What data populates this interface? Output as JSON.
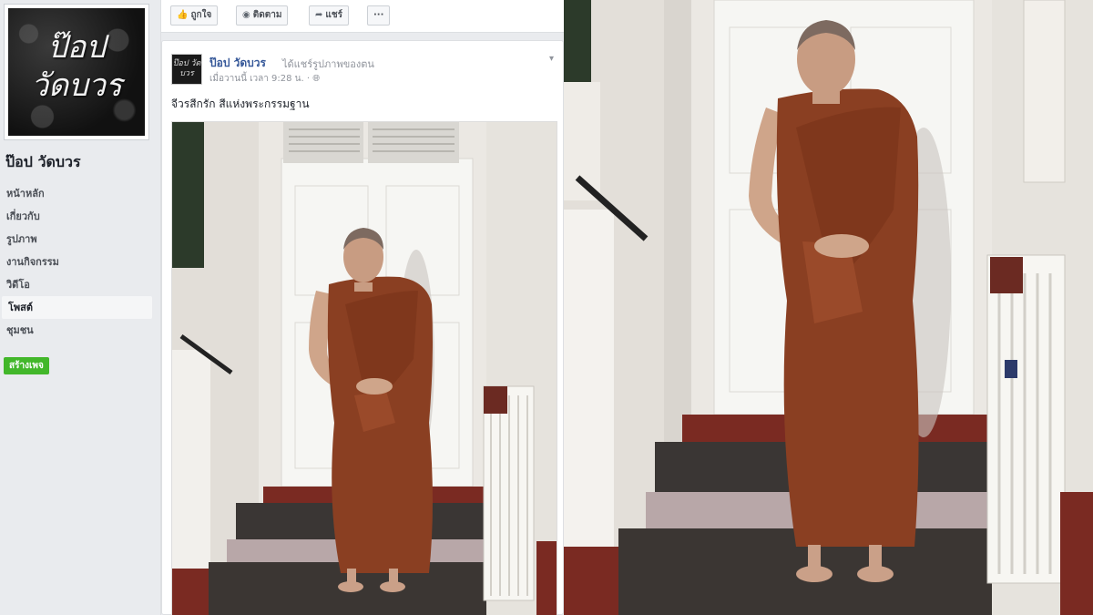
{
  "sidebar": {
    "logo_text_line1": "ป๊อป",
    "logo_text_line2": "วัดบวร",
    "page_name": "ป๊อป วัดบวร",
    "nav": [
      "หน้าหลัก",
      "เกี่ยวกับ",
      "รูปภาพ",
      "งานกิจกรรม",
      "วิดีโอ",
      "โพสต์",
      "ชุมชน"
    ],
    "active_index": 5,
    "create_page_label": "สร้างเพจ"
  },
  "action_bar": {
    "like_label": "ถูกใจ",
    "follow_label": "ติดตาม",
    "share_label": "แชร์",
    "more_label": "···"
  },
  "post": {
    "avatar_text": "ป๊อป วัดบวร",
    "author": "ป๊อป วัดบวร",
    "action": "ได้แชร์รูปภาพของตน",
    "time": "เมื่อวานนี้ เวลา 9:28 น. ·",
    "text": "จีวรสีกรัก สีแห่งพระกรรมฐาน"
  },
  "colors": {
    "robe": "#8a3f22",
    "link": "#365899",
    "green": "#42b72a"
  }
}
